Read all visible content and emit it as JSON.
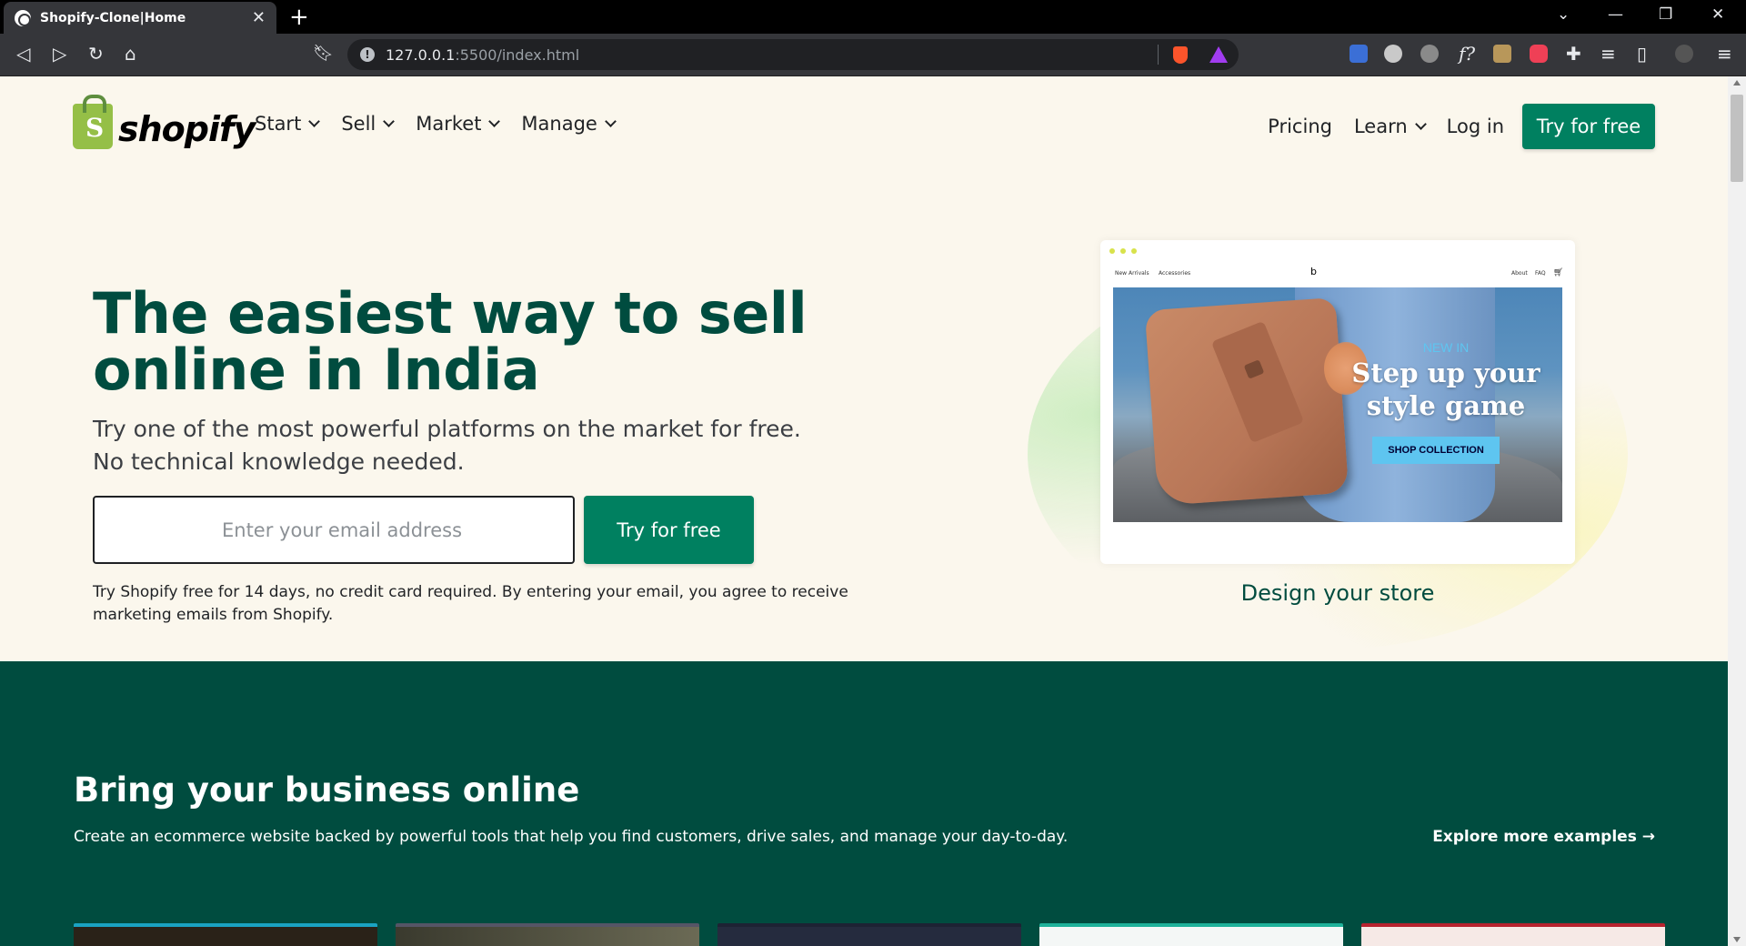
{
  "browser": {
    "tab_title": "Shopify-Clone|Home",
    "url_host": "127.0.0.1",
    "url_rest": ":5500/index.html"
  },
  "nav": {
    "logo_text": "shopify",
    "left_items": [
      "Start",
      "Sell",
      "Market",
      "Manage"
    ],
    "pricing": "Pricing",
    "learn": "Learn",
    "login": "Log in",
    "cta": "Try for free"
  },
  "hero": {
    "title": "The easiest way to sell online in India",
    "subtitle_line1": "Try one of the most powerful platforms on the market for free.",
    "subtitle_line2": "No technical knowledge needed.",
    "email_placeholder": "Enter your email address",
    "cta": "Try for free",
    "note": "Try Shopify free for 14 days, no credit card required. By entering your email, you agree to receive marketing emails from Shopify."
  },
  "mockup": {
    "nav_new_arrivals": "New Arrivals",
    "nav_accessories": "Accessories",
    "logo_letter": "b",
    "nav_about": "About",
    "nav_faq": "FAQ",
    "new_in": "NEW IN",
    "headline": "Step up your style game",
    "button": "SHOP COLLECTION",
    "caption": "Design your store"
  },
  "business": {
    "title": "Bring your business online",
    "description": "Create an ecommerce website backed by powerful tools that help you find customers, drive sales, and manage your day-to-day.",
    "link": "Explore more examples →"
  },
  "colors": {
    "brand_green": "#008060",
    "dark_green": "#004c3f",
    "page_bg": "#fbf7ed"
  }
}
